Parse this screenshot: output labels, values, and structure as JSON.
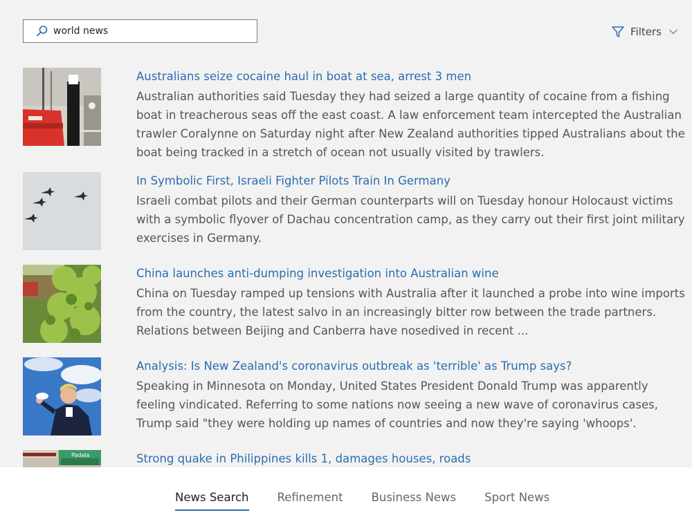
{
  "search": {
    "value": "world news",
    "icon": "search-icon"
  },
  "filters": {
    "label": "Filters",
    "icon": "funnel-icon"
  },
  "results": [
    {
      "title": "Australians seize cocaine haul in boat at sea, arrest 3 men",
      "description": "Australian authorities said Tuesday they had seized a large quantity of cocaine from a fishing boat in treacherous seas off the east coast. A law enforcement team intercepted the Australian trawler Coralynne on Saturday night after New Zealand authorities tipped Australians about the boat being tracked in a stretch of ocean not usually visited by trawlers."
    },
    {
      "title": "In Symbolic First, Israeli Fighter Pilots Train In Germany",
      "description": "Israeli combat pilots and their German counterparts will on Tuesday honour Holocaust victims with a symbolic flyover of Dachau concentration camp, as they carry out their first joint military exercises in Germany."
    },
    {
      "title": "China launches anti-dumping investigation into Australian wine",
      "description": "China on Tuesday ramped up tensions with Australia after it launched a probe into wine imports from the country, the latest salvo in an increasingly bitter row between the trade partners. Relations between Beijing and Canberra have nosedived in recent ..."
    },
    {
      "title": "Analysis: Is New Zealand's coronavirus outbreak as 'terrible' as Trump says?",
      "description": "Speaking in Minnesota on Monday, United States President Donald Trump was apparently feeling vindicated. Referring to some nations now seeing a new wave of coronavirus cases, Trump said \"they were holding up names of countries and now they're saying 'whoops'."
    },
    {
      "title": "Strong quake in Philippines kills 1, damages houses, roads",
      "description": "",
      "thumb_text": "Padala"
    }
  ],
  "tabs": [
    {
      "label": "News Search",
      "active": true
    },
    {
      "label": "Refinement",
      "active": false
    },
    {
      "label": "Business News",
      "active": false
    },
    {
      "label": "Sport News",
      "active": false
    }
  ],
  "colors": {
    "link": "#2b6cb0",
    "background": "#f2f2f2",
    "tab_underline": "#2b6cb0"
  }
}
